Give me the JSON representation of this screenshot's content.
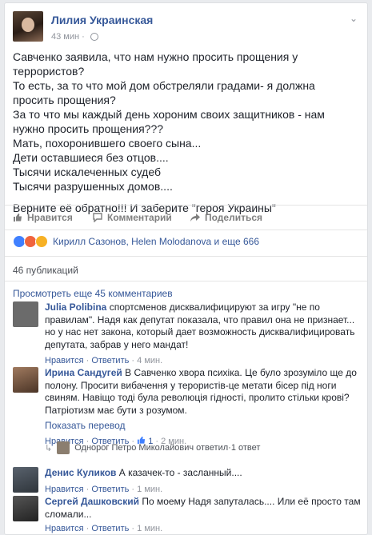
{
  "post": {
    "author": "Лилия Украинская",
    "time": "43 мин",
    "paragraph1": [
      "Савченко заявила, что нам нужно просить прощения у террористов?",
      "То есть, за то что мой дом обстреляли градами- я должна просить прощения?",
      "За то что мы каждый день хороним своих защитников - нам нужно просить прощения???",
      "Мать, похоронившего своего сына...",
      "Дети оставшиеся без отцов....",
      "Тысячи искалеченных судеб",
      "Тысячи разрушенных домов...."
    ],
    "paragraph2": "Верните её обратно!!! И заберите \"героя Украины\""
  },
  "actions": {
    "like": "Нравится",
    "comment": "Комментарий",
    "share": "Поделиться"
  },
  "reactions_text": "Кирилл Сазонов, Helen Molodanova и еще 666",
  "shares_text": "46 публикаций",
  "more_comments": "Просмотреть еще 45 комментариев",
  "comments": [
    {
      "name": "Julia Polibina",
      "text": "спортсменов дисквалифицируют за игру \"не по правилам\". Надя как депутат показала, что правил она не признает... но у нас нет закона, который дает возможность дисквалифицировать депутата, забрав у него мандат!",
      "like": "Нравится",
      "reply": "Ответить",
      "time": "4 мин."
    },
    {
      "name": "Ирина Сандугей",
      "text": "В Савченко хвора психіка. Це було зрозуміло ще до полону. Просити вибачення у терористів-це метати бісер під ноги свиням. Навіщо тоді була революція гідності, пролито стільки крові? Патріотизм має бути з розумом.",
      "translate": "Показать перевод",
      "like": "Нравится",
      "reply": "Ответить",
      "likes": "1",
      "time": "2 мин."
    },
    {
      "name": "Денис Куликов",
      "text": "А казачек-то - засланный....",
      "like": "Нравится",
      "reply": "Ответить",
      "time": "1 мин."
    },
    {
      "name": "Сергей Дашковский",
      "text": "По моему Надя запуталась.... Или её просто там сломали...",
      "like": "Нравится",
      "reply": "Ответить",
      "time": "1 мин."
    }
  ],
  "reply_summary": {
    "name": "Однорог Петро Миколайович",
    "verb": "ответил",
    "count": "1 ответ"
  },
  "sep": " · ",
  "colors": {
    "link": "#365899",
    "muted": "#90949c",
    "like_reaction": "#4080ff",
    "angry_reaction": "#f0643e",
    "wow_reaction": "#f7b125"
  }
}
